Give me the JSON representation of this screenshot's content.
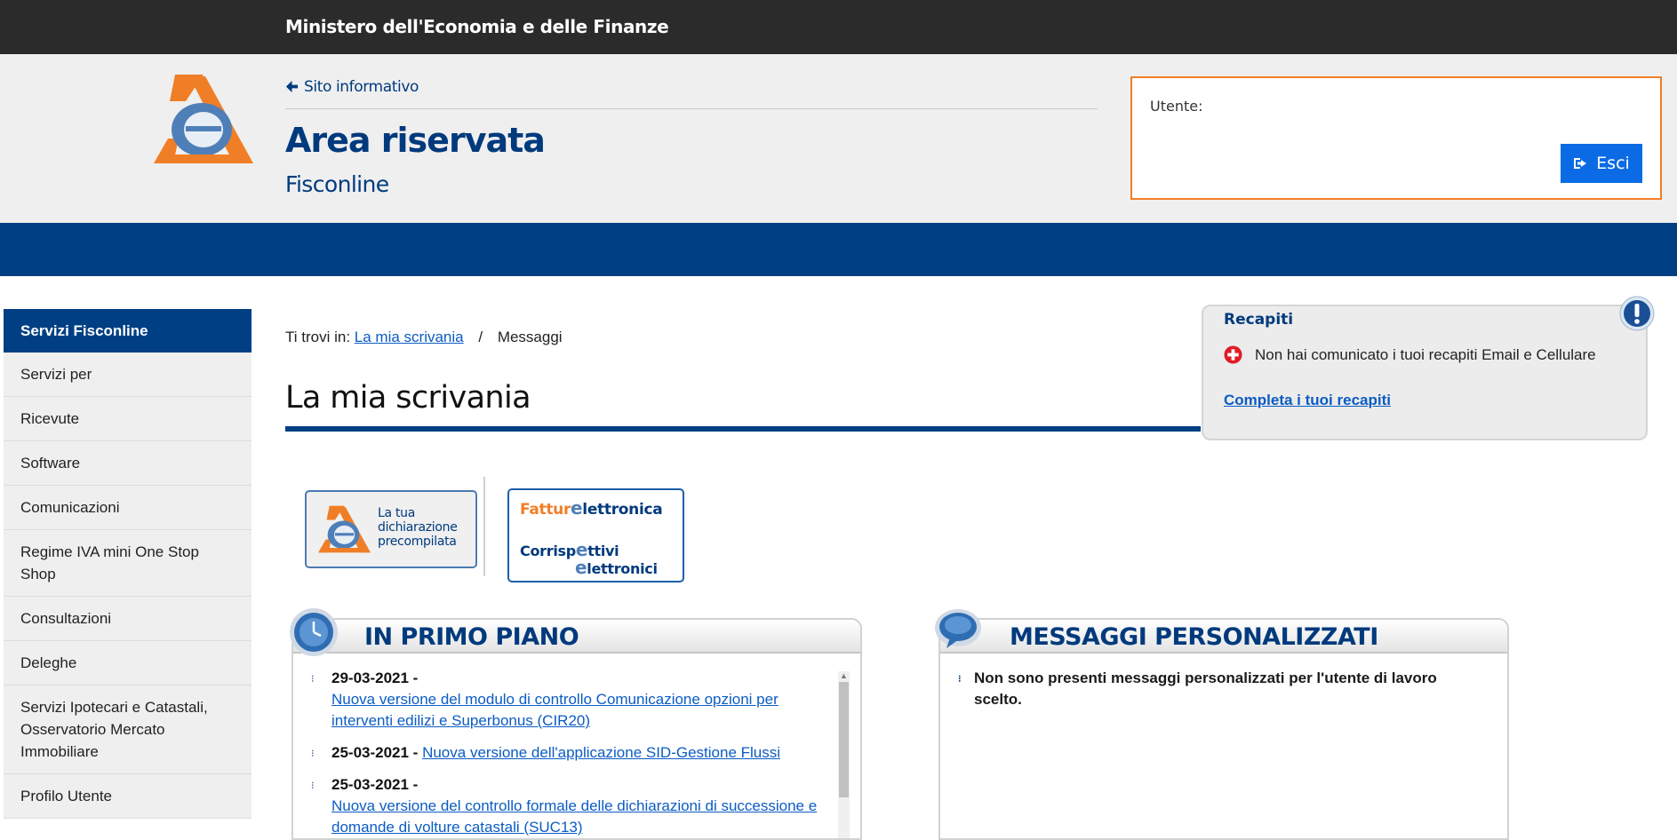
{
  "ribbon": {
    "title": "Ministero dell'Economia e delle Finanze"
  },
  "header": {
    "back_link": "Sito informativo",
    "title": "Area riservata",
    "subtitle": "Fisconline",
    "user_label": "Utente:",
    "logout_label": "Esci"
  },
  "sidebar": {
    "heading": "Servizi Fisconline",
    "items": [
      {
        "label": "Servizi per"
      },
      {
        "label": "Ricevute"
      },
      {
        "label": "Software"
      },
      {
        "label": "Comunicazioni"
      },
      {
        "label": "Regime IVA mini One Stop Shop"
      },
      {
        "label": "Consultazioni"
      },
      {
        "label": "Deleghe"
      },
      {
        "label": "Servizi Ipotecari e Catastali, Osservatorio Mercato Immobiliare"
      },
      {
        "label": "Profilo Utente"
      }
    ]
  },
  "breadcrumb": {
    "prefix": "Ti trovi in:",
    "link": "La mia scrivania",
    "separator": "/",
    "current": "Messaggi"
  },
  "page_title": "La mia scrivania",
  "recapiti": {
    "title": "Recapiti",
    "message": "Non hai comunicato i tuoi recapiti Email e Cellulare",
    "link": "Completa i tuoi recapiti"
  },
  "banners": {
    "precompilata": "La tua dichiarazione precompilata",
    "fattura_1": "Fattur",
    "fattura_2": "lettronica",
    "corrisp_1": "Corrisp",
    "corrisp_2": "ttivi",
    "corrisp_3": "lettronici"
  },
  "primo_piano": {
    "title": "IN PRIMO PIANO",
    "items": [
      {
        "date": "29-03-2021 -",
        "link": "Nuova versione del modulo di controllo Comunicazione opzioni per interventi edilizi e Superbonus (CIR20)"
      },
      {
        "date": "25-03-2021 -",
        "link": "Nuova versione dell'applicazione SID-Gestione Flussi"
      },
      {
        "date": "25-03-2021 -",
        "link": "Nuova versione del controllo formale delle dichiarazioni di successione e domande di volture catastali (SUC13)"
      }
    ]
  },
  "messaggi": {
    "title": "MESSAGGI PERSONALIZZATI",
    "text": "Non sono presenti messaggi personalizzati per l'utente di lavoro scelto."
  },
  "colors": {
    "brand_blue": "#003f84",
    "accent_orange": "#f07e26",
    "button_blue": "#0b6be5",
    "link_blue": "#0b5cc3"
  }
}
